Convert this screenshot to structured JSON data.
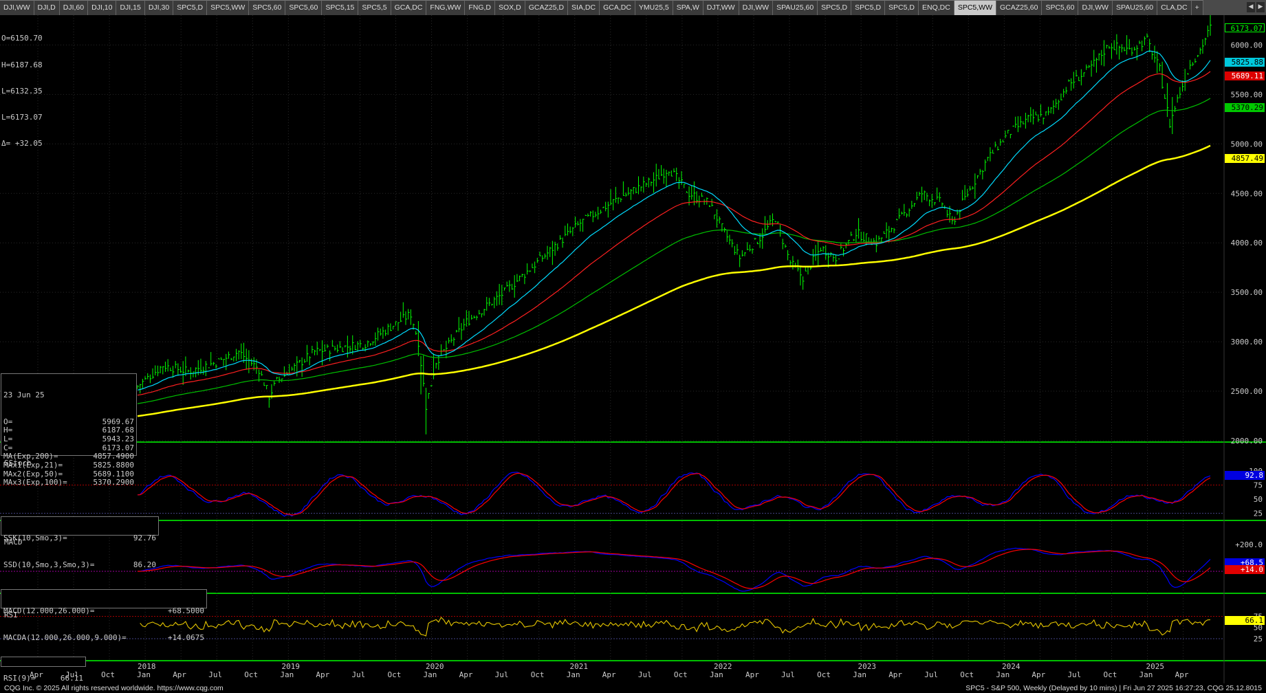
{
  "tabs": [
    "DJI,WW",
    "DJI,D",
    "DJI,60",
    "DJI,10",
    "DJI,15",
    "DJI,30",
    "SPC5,D",
    "SPC5,WW",
    "SPC5,60",
    "SPC5,60",
    "SPC5,15",
    "SPC5,5",
    "GCA,DC",
    "FNG,WW",
    "FNG,D",
    "SOX,D",
    "GCAZ25,D",
    "SIA,DC",
    "GCA,DC",
    "YMU25,5",
    "SPA,W",
    "DJT,WW",
    "DJI,WW",
    "SPAU25,60",
    "SPC5,D",
    "SPC5,D",
    "SPC5,D",
    "ENQ,DC",
    "SPC5,WW",
    "GCAZ25,60",
    "SPC5,60",
    "DJI,WW",
    "SPAU25,60",
    "CLA,DC",
    "+"
  ],
  "active_tab_index": 28,
  "ohlc_top": {
    "o": "O=6150.70",
    "h": "H=6187.68",
    "l": "L=6132.35",
    "l2": "L=6173.07",
    "d": "Δ= +32.05"
  },
  "bar_info": {
    "date": "23 Jun 25",
    "rows": [
      {
        "label": "O=",
        "value": "5969.67"
      },
      {
        "label": "H=",
        "value": "6187.68"
      },
      {
        "label": "L=",
        "value": "5943.23"
      },
      {
        "label": "C=",
        "value": "6173.07"
      },
      {
        "label": "MA(Exp,200)=",
        "value": "4857.4900"
      },
      {
        "label": "MAx1(Exp,21)=",
        "value": "5825.8800"
      },
      {
        "label": "MAx2(Exp,50)=",
        "value": "5689.1100"
      },
      {
        "label": "MAx3(Exp,100)=",
        "value": "5370.2900"
      }
    ]
  },
  "price_tags": [
    {
      "value": "6173.07",
      "price": 6173.07,
      "bg": "#000000",
      "fg": "#00ff00",
      "border": "#00ff00"
    },
    {
      "value": "5825.88",
      "price": 5825.88,
      "bg": "#00c8dc",
      "fg": "#000000"
    },
    {
      "value": "5689.11",
      "price": 5689.11,
      "bg": "#dc0000",
      "fg": "#ffffff"
    },
    {
      "value": "5370.29",
      "price": 5370.29,
      "bg": "#00c800",
      "fg": "#000000"
    },
    {
      "value": "4857.49",
      "price": 4857.49,
      "bg": "#ffff00",
      "fg": "#000000"
    }
  ],
  "price_axis": [
    "6000.00",
    "5500.00",
    "5000.00",
    "4500.00",
    "4000.00",
    "3500.00",
    "3000.00",
    "2500.00",
    "2000.00"
  ],
  "price_axis_values": [
    6000,
    5500,
    5000,
    4500,
    4000,
    3500,
    3000,
    2500,
    2000
  ],
  "sstoch": {
    "title": "SStoch",
    "k_label": "SSK(10,Smo,3)=",
    "k_value": "92.76",
    "d_label": "SSD(10,Smo,3,Smo,3)=",
    "d_value": "86.20",
    "axis": [
      "100",
      "75",
      "50",
      "25"
    ],
    "tag_k": "92.8",
    "tag_d": "86.2"
  },
  "macd": {
    "title": "MACD",
    "macd_label": "MACD(12.000,26.000)=",
    "macd_value": "+68.5000",
    "macda_label": "MACDA(12.000,26.000,9.000)=",
    "macda_value": "+14.0675",
    "axis": [
      "+200.0"
    ],
    "tag_macd": "+68.5",
    "tag_signal": "+14.0"
  },
  "rsi": {
    "title": "RSI",
    "label": "RSI(9)=",
    "value": "66.11",
    "axis": [
      "75",
      "50",
      "25"
    ],
    "tag": "66.1"
  },
  "time_axis": {
    "years": [
      "2018",
      "2019",
      "2020",
      "2021",
      "2022",
      "2023",
      "2024",
      "2025"
    ],
    "months": [
      "Apr",
      "Jul",
      "Oct",
      "Jan",
      "Apr",
      "Jul",
      "Oct",
      "Jan",
      "Apr",
      "Jul",
      "Oct",
      "Jan",
      "Apr",
      "Jul",
      "Oct",
      "Jan",
      "Apr",
      "Jul",
      "Oct",
      "Jan",
      "Apr",
      "Jul",
      "Oct",
      "Jan",
      "Apr",
      "Jul",
      "Oct",
      "Jan",
      "Apr",
      "Jul",
      "Oct",
      "Jan",
      "Apr"
    ]
  },
  "colors": {
    "bars": "#00ff00",
    "ma200": "#ffff00",
    "ma21": "#00dcff",
    "ma50": "#ff2020",
    "ma100": "#00c000",
    "osc_fast": "#0000ff",
    "osc_slow": "#ff0000",
    "rsi": "#e8c800",
    "separator": "#00c000"
  },
  "footer": {
    "left": "CQG Inc. © 2025 All rights reserved worldwide. https://www.cqg.com",
    "right": "SPC5 - S&P 500, Weekly (Delayed by 10 mins) | Fri Jun 27 2025 16:27:23, CQG 25.12.8015"
  }
}
